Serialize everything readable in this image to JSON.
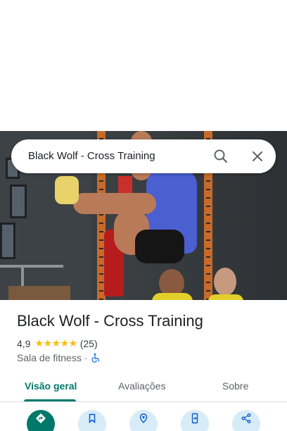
{
  "place": {
    "name": "Black Wolf - Cross Training",
    "rating": "4,9",
    "stars": "★★★★★",
    "review_count": "(25)",
    "category": "Sala de fitness",
    "separator": "·"
  },
  "search": {
    "query": "Black Wolf - Cross Training"
  },
  "tabs": [
    {
      "label": "Visão geral",
      "active": true
    },
    {
      "label": "Avaliações",
      "active": false
    },
    {
      "label": "Sobre",
      "active": false
    }
  ],
  "actions": [
    {
      "icon": "directions-icon"
    },
    {
      "icon": "save-icon"
    },
    {
      "icon": "nearby-icon"
    },
    {
      "icon": "send-to-phone-icon"
    },
    {
      "icon": "share-icon"
    }
  ],
  "colors": {
    "accent": "#00796b",
    "star": "#fbbc04",
    "action_bg": "#d8ecf8"
  }
}
